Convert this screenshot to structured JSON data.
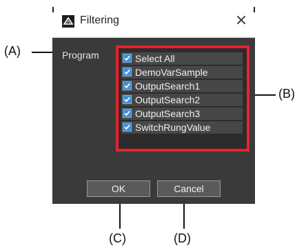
{
  "dialog": {
    "title": "Filtering",
    "close_glyph": "×",
    "program_label": "Program",
    "items": [
      {
        "label": "Select All",
        "checked": true
      },
      {
        "label": "DemoVarSample",
        "checked": true
      },
      {
        "label": "OutputSearch1",
        "checked": true
      },
      {
        "label": "OutputSearch2",
        "checked": true
      },
      {
        "label": "OutputSearch3",
        "checked": true
      },
      {
        "label": "SwitchRungValue",
        "checked": true
      }
    ],
    "ok_label": "OK",
    "cancel_label": "Cancel"
  },
  "callouts": {
    "a": "(A)",
    "b": "(B)",
    "c": "(C)",
    "d": "(D)"
  },
  "colors": {
    "highlight_frame": "#e8222f",
    "dialog_bg": "#3a3a3a",
    "checkbox": "#3f8ed6"
  },
  "icons": {
    "app": "app-logo-icon",
    "close": "close-icon",
    "check": "checkmark-icon"
  }
}
